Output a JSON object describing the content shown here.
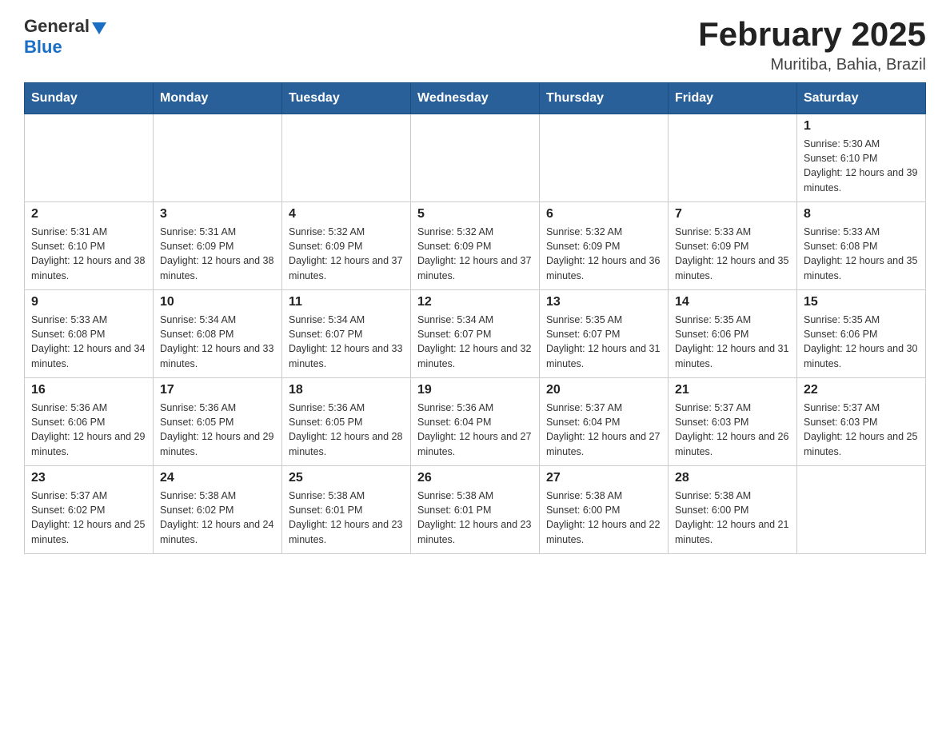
{
  "header": {
    "logo_general": "General",
    "logo_blue": "Blue",
    "month_title": "February 2025",
    "location": "Muritiba, Bahia, Brazil"
  },
  "days_of_week": [
    "Sunday",
    "Monday",
    "Tuesday",
    "Wednesday",
    "Thursday",
    "Friday",
    "Saturday"
  ],
  "weeks": [
    {
      "days": [
        {
          "num": "",
          "info": ""
        },
        {
          "num": "",
          "info": ""
        },
        {
          "num": "",
          "info": ""
        },
        {
          "num": "",
          "info": ""
        },
        {
          "num": "",
          "info": ""
        },
        {
          "num": "",
          "info": ""
        },
        {
          "num": "1",
          "info": "Sunrise: 5:30 AM\nSunset: 6:10 PM\nDaylight: 12 hours and 39 minutes."
        }
      ]
    },
    {
      "days": [
        {
          "num": "2",
          "info": "Sunrise: 5:31 AM\nSunset: 6:10 PM\nDaylight: 12 hours and 38 minutes."
        },
        {
          "num": "3",
          "info": "Sunrise: 5:31 AM\nSunset: 6:09 PM\nDaylight: 12 hours and 38 minutes."
        },
        {
          "num": "4",
          "info": "Sunrise: 5:32 AM\nSunset: 6:09 PM\nDaylight: 12 hours and 37 minutes."
        },
        {
          "num": "5",
          "info": "Sunrise: 5:32 AM\nSunset: 6:09 PM\nDaylight: 12 hours and 37 minutes."
        },
        {
          "num": "6",
          "info": "Sunrise: 5:32 AM\nSunset: 6:09 PM\nDaylight: 12 hours and 36 minutes."
        },
        {
          "num": "7",
          "info": "Sunrise: 5:33 AM\nSunset: 6:09 PM\nDaylight: 12 hours and 35 minutes."
        },
        {
          "num": "8",
          "info": "Sunrise: 5:33 AM\nSunset: 6:08 PM\nDaylight: 12 hours and 35 minutes."
        }
      ]
    },
    {
      "days": [
        {
          "num": "9",
          "info": "Sunrise: 5:33 AM\nSunset: 6:08 PM\nDaylight: 12 hours and 34 minutes."
        },
        {
          "num": "10",
          "info": "Sunrise: 5:34 AM\nSunset: 6:08 PM\nDaylight: 12 hours and 33 minutes."
        },
        {
          "num": "11",
          "info": "Sunrise: 5:34 AM\nSunset: 6:07 PM\nDaylight: 12 hours and 33 minutes."
        },
        {
          "num": "12",
          "info": "Sunrise: 5:34 AM\nSunset: 6:07 PM\nDaylight: 12 hours and 32 minutes."
        },
        {
          "num": "13",
          "info": "Sunrise: 5:35 AM\nSunset: 6:07 PM\nDaylight: 12 hours and 31 minutes."
        },
        {
          "num": "14",
          "info": "Sunrise: 5:35 AM\nSunset: 6:06 PM\nDaylight: 12 hours and 31 minutes."
        },
        {
          "num": "15",
          "info": "Sunrise: 5:35 AM\nSunset: 6:06 PM\nDaylight: 12 hours and 30 minutes."
        }
      ]
    },
    {
      "days": [
        {
          "num": "16",
          "info": "Sunrise: 5:36 AM\nSunset: 6:06 PM\nDaylight: 12 hours and 29 minutes."
        },
        {
          "num": "17",
          "info": "Sunrise: 5:36 AM\nSunset: 6:05 PM\nDaylight: 12 hours and 29 minutes."
        },
        {
          "num": "18",
          "info": "Sunrise: 5:36 AM\nSunset: 6:05 PM\nDaylight: 12 hours and 28 minutes."
        },
        {
          "num": "19",
          "info": "Sunrise: 5:36 AM\nSunset: 6:04 PM\nDaylight: 12 hours and 27 minutes."
        },
        {
          "num": "20",
          "info": "Sunrise: 5:37 AM\nSunset: 6:04 PM\nDaylight: 12 hours and 27 minutes."
        },
        {
          "num": "21",
          "info": "Sunrise: 5:37 AM\nSunset: 6:03 PM\nDaylight: 12 hours and 26 minutes."
        },
        {
          "num": "22",
          "info": "Sunrise: 5:37 AM\nSunset: 6:03 PM\nDaylight: 12 hours and 25 minutes."
        }
      ]
    },
    {
      "days": [
        {
          "num": "23",
          "info": "Sunrise: 5:37 AM\nSunset: 6:02 PM\nDaylight: 12 hours and 25 minutes."
        },
        {
          "num": "24",
          "info": "Sunrise: 5:38 AM\nSunset: 6:02 PM\nDaylight: 12 hours and 24 minutes."
        },
        {
          "num": "25",
          "info": "Sunrise: 5:38 AM\nSunset: 6:01 PM\nDaylight: 12 hours and 23 minutes."
        },
        {
          "num": "26",
          "info": "Sunrise: 5:38 AM\nSunset: 6:01 PM\nDaylight: 12 hours and 23 minutes."
        },
        {
          "num": "27",
          "info": "Sunrise: 5:38 AM\nSunset: 6:00 PM\nDaylight: 12 hours and 22 minutes."
        },
        {
          "num": "28",
          "info": "Sunrise: 5:38 AM\nSunset: 6:00 PM\nDaylight: 12 hours and 21 minutes."
        },
        {
          "num": "",
          "info": ""
        }
      ]
    }
  ]
}
